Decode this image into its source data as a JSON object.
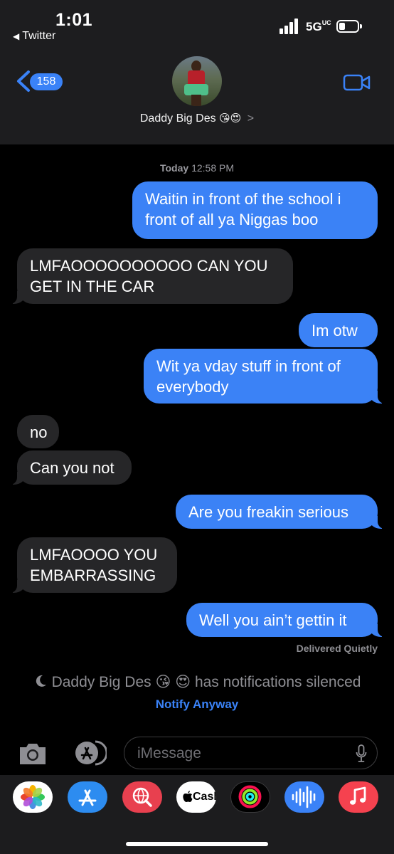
{
  "status_bar": {
    "time": "1:01",
    "back_app": "Twitter",
    "network": "5G",
    "network_suffix": "UC"
  },
  "header": {
    "back_count": "158",
    "contact_name": "Daddy Big Des",
    "contact_emojis": "😘😍",
    "chevron": ">"
  },
  "thread": {
    "timestamp_day": "Today",
    "timestamp_time": "12:58 PM",
    "messages": [
      {
        "from": "me",
        "line1": "Waitin in front of the school i",
        "line2": "front of all ya Niggas boo"
      },
      {
        "from": "them",
        "line1": "LMFAOOOOOOOOOO CAN YOU",
        "line2": "GET IN THE CAR"
      },
      {
        "from": "me",
        "line1": "Im otw"
      },
      {
        "from": "me",
        "line1": "Wit ya vday stuff in front of",
        "line2": "everybody"
      },
      {
        "from": "them",
        "line1": "no"
      },
      {
        "from": "them",
        "line1": "Can you not"
      },
      {
        "from": "me",
        "line1": "Are you freakin serious"
      },
      {
        "from": "them",
        "line1": "LMFAOOOO YOU",
        "line2": "EMBARRASSING"
      },
      {
        "from": "me",
        "line1": "Well you ain’t gettin it"
      }
    ],
    "delivered": "Delivered Quietly",
    "silenced_name": "Daddy Big Des",
    "silenced_emojis": "😘 😍",
    "silenced_text": "has notifications silenced",
    "notify_anyway": "Notify Anyway"
  },
  "compose": {
    "placeholder": "iMessage"
  },
  "app_drawer": {
    "apps": [
      "photos-icon",
      "app-store-icon",
      "search-web-icon",
      "apple-cash-icon",
      "fitness-icon",
      "audio-message-icon",
      "music-icon"
    ],
    "cash_label": "Cash"
  },
  "colors": {
    "outgoing_bubble": "#3b82f6",
    "incoming_bubble": "#262628",
    "accent": "#3a82f7"
  }
}
